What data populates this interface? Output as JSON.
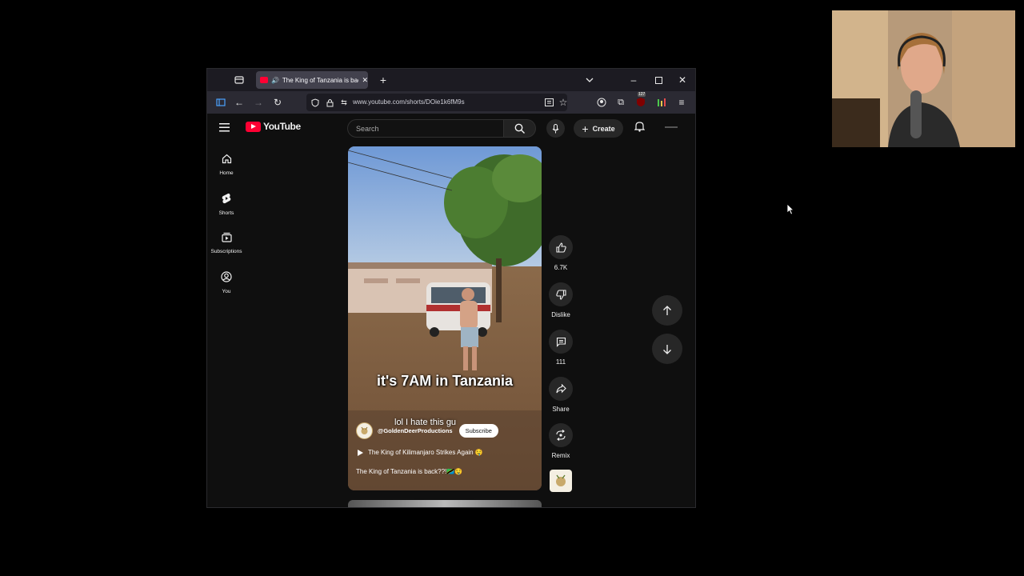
{
  "browser": {
    "tab_title": "The King of Tanzania is back",
    "url": "www.youtube.com/shorts/DOie1k6fM9s",
    "badge_count": "127"
  },
  "youtube": {
    "logo_text": "YouTube",
    "search_placeholder": "Search",
    "create_label": "Create",
    "sidebar": [
      {
        "label": "Home",
        "icon": "home-icon"
      },
      {
        "label": "Shorts",
        "icon": "shorts-icon"
      },
      {
        "label": "Subscriptions",
        "icon": "subscriptions-icon"
      },
      {
        "label": "You",
        "icon": "you-icon"
      }
    ]
  },
  "short": {
    "caption_main": "it's 7AM in Tanzania",
    "caption_sub": "lol I hate this gu",
    "channel": "@GoldenDeerProductions",
    "subscribe_label": "Subscribe",
    "sound_title": "The King of Kilimanjaro Strikes Again 🤤",
    "description": "The King of Tanzania is back??!🇹🇿🤤",
    "actions": {
      "likes": "6.7K",
      "dislike": "Dislike",
      "comments": "111",
      "share": "Share",
      "remix": "Remix"
    }
  },
  "colors": {
    "yt_red": "#ff0033",
    "page_bg": "#0f0f0f",
    "button_bg": "#272727"
  }
}
